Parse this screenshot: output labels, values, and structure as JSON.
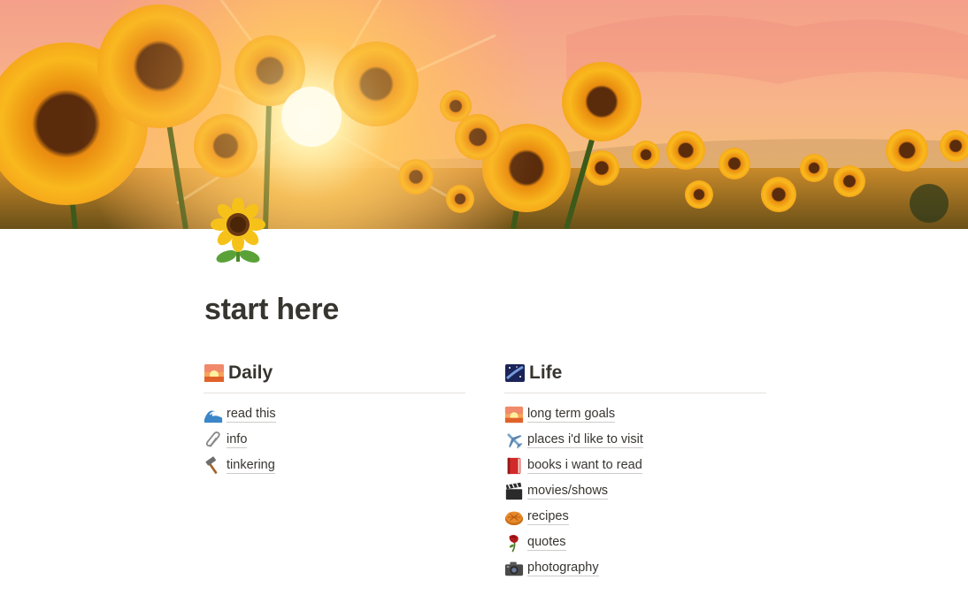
{
  "page": {
    "title": "start here",
    "icon": "sunflower-icon"
  },
  "cover": {
    "description_icon": "sunflower-field-cover-icon",
    "colors": {
      "sky_top": "#f6a98a",
      "sun": "#fff6c8",
      "petal": "#f7b21a",
      "center": "#5a2a0a"
    }
  },
  "columns": [
    {
      "heading": "Daily",
      "icon": "sunrise-icon",
      "items": [
        {
          "label": "read this",
          "icon": "wave-icon"
        },
        {
          "label": "info",
          "icon": "paperclip-icon"
        },
        {
          "label": "tinkering",
          "icon": "hammer-icon"
        }
      ]
    },
    {
      "heading": "Life",
      "icon": "milky-way-icon",
      "items": [
        {
          "label": "long term goals",
          "icon": "sunrise-icon"
        },
        {
          "label": "places i'd like to visit",
          "icon": "airplane-icon"
        },
        {
          "label": "books i want to read",
          "icon": "red-book-icon"
        },
        {
          "label": "movies/shows",
          "icon": "clapper-icon"
        },
        {
          "label": "recipes",
          "icon": "pie-icon"
        },
        {
          "label": "quotes",
          "icon": "wilted-rose-icon"
        },
        {
          "label": "photography",
          "icon": "camera-icon"
        }
      ]
    }
  ]
}
